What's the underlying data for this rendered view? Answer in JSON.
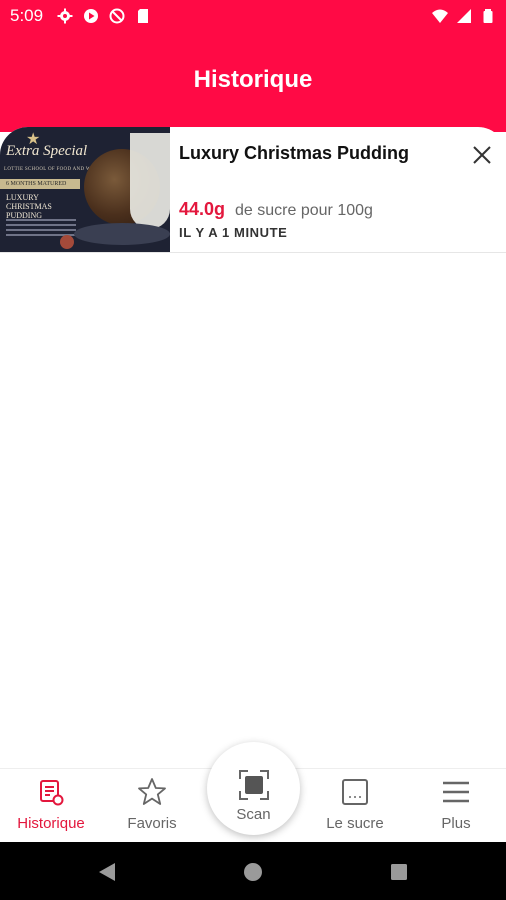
{
  "status_bar": {
    "time": "5:09",
    "left_icons": [
      "gear-icon",
      "play-store-icon",
      "do-not-disturb-icon",
      "sd-card-icon"
    ],
    "right_icons": [
      "wifi-icon",
      "signal-icon",
      "battery-icon"
    ]
  },
  "header": {
    "title": "Historique"
  },
  "history": {
    "items": [
      {
        "title": "Luxury Christmas Pudding",
        "sugar_value": "44.0g",
        "sugar_text": "de sucre pour 100g",
        "timestamp": "IL Y A 1 MINUTE",
        "image_text": {
          "brand": "Extra Special",
          "subbrand": "LOTTIE SCHOOL OF FOOD AND WINE",
          "band": "6 MONTHS MATURED",
          "product": "LUXURY CHRISTMAS PUDDING"
        }
      }
    ]
  },
  "bottom_nav": {
    "items": [
      {
        "label": "Historique",
        "icon": "history-icon",
        "active": true
      },
      {
        "label": "Favoris",
        "icon": "star-icon",
        "active": false
      },
      {
        "label": "Scan",
        "icon": "scan-icon",
        "active": false
      },
      {
        "label": "Le sucre",
        "icon": "sugar-cube-icon",
        "active": false
      },
      {
        "label": "Plus",
        "icon": "menu-icon",
        "active": false
      }
    ]
  },
  "colors": {
    "primary": "#ff0a45",
    "accent_text": "#e3173d",
    "muted_text": "#666666"
  }
}
